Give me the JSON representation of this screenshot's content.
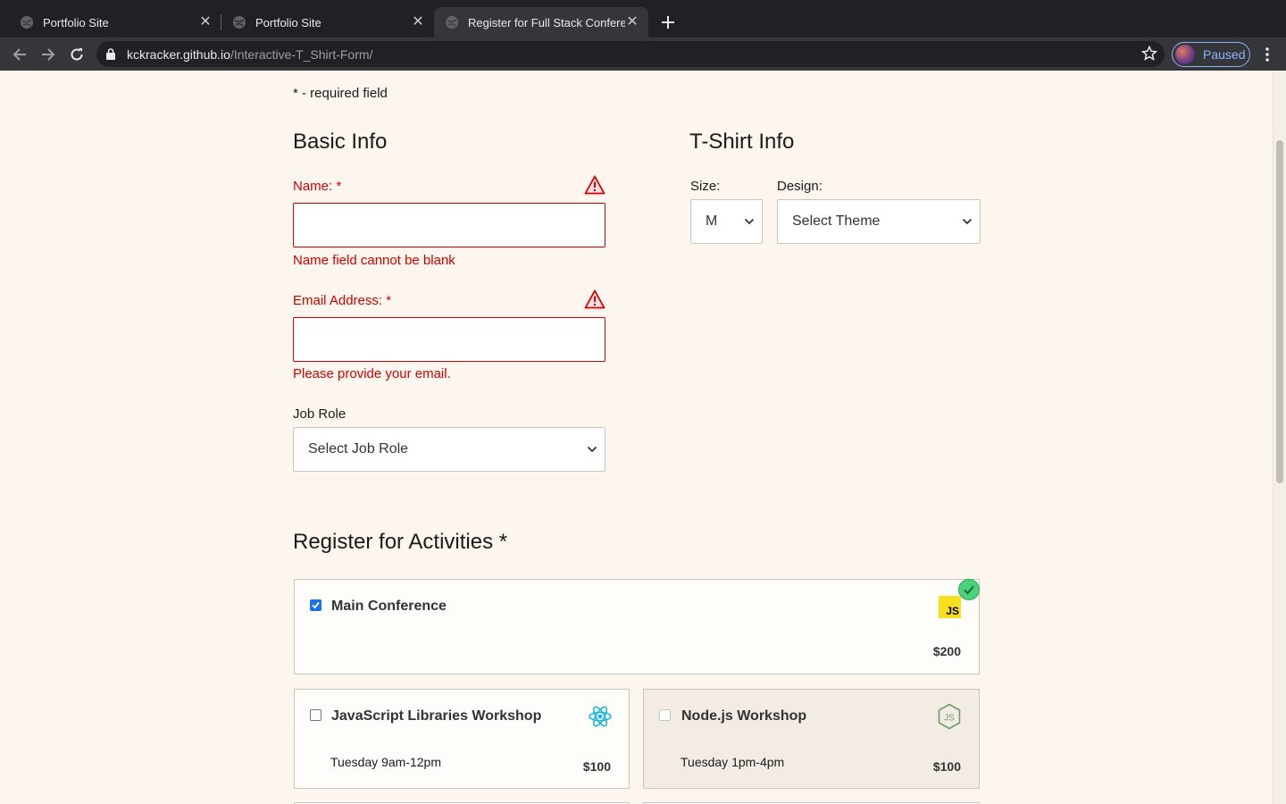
{
  "browser": {
    "tabs": [
      {
        "title": "Portfolio Site",
        "active": false
      },
      {
        "title": "Portfolio Site",
        "active": false
      },
      {
        "title": "Register for Full Stack Conference",
        "active": true
      }
    ],
    "url_host": "kckracker.github.io",
    "url_path": "/Interactive-T_Shirt-Form/",
    "profile_label": "Paused"
  },
  "form": {
    "required_note": "- required field",
    "required_mark": "*",
    "basic_info": {
      "heading": "Basic Info",
      "name_label": "Name:",
      "name_value": "",
      "name_error": "Name field cannot be blank",
      "email_label": "Email Address:",
      "email_value": "",
      "email_error": "Please provide your email.",
      "job_role_label": "Job Role",
      "job_role_selected": "Select Job Role"
    },
    "tshirt_info": {
      "heading": "T-Shirt Info",
      "size_label": "Size:",
      "size_selected": "M",
      "design_label": "Design:",
      "design_selected": "Select Theme"
    },
    "activities": {
      "heading": "Register for Activities",
      "items": [
        {
          "name": "Main Conference",
          "time": "",
          "price": "$200",
          "checked": true,
          "disabled": false,
          "icon": "javascript-icon"
        },
        {
          "name": "JavaScript Libraries Workshop",
          "time": "Tuesday 9am-12pm",
          "price": "$100",
          "checked": false,
          "disabled": false,
          "icon": "react-icon"
        },
        {
          "name": "Node.js Workshop",
          "time": "Tuesday 1pm-4pm",
          "price": "$100",
          "checked": false,
          "disabled": true,
          "icon": "nodejs-icon"
        }
      ]
    }
  },
  "colors": {
    "error": "#d50000",
    "page_background": "#fcf6ee",
    "checkbox_accent": "#1a73e8",
    "success_badge": "#4cd17b"
  }
}
